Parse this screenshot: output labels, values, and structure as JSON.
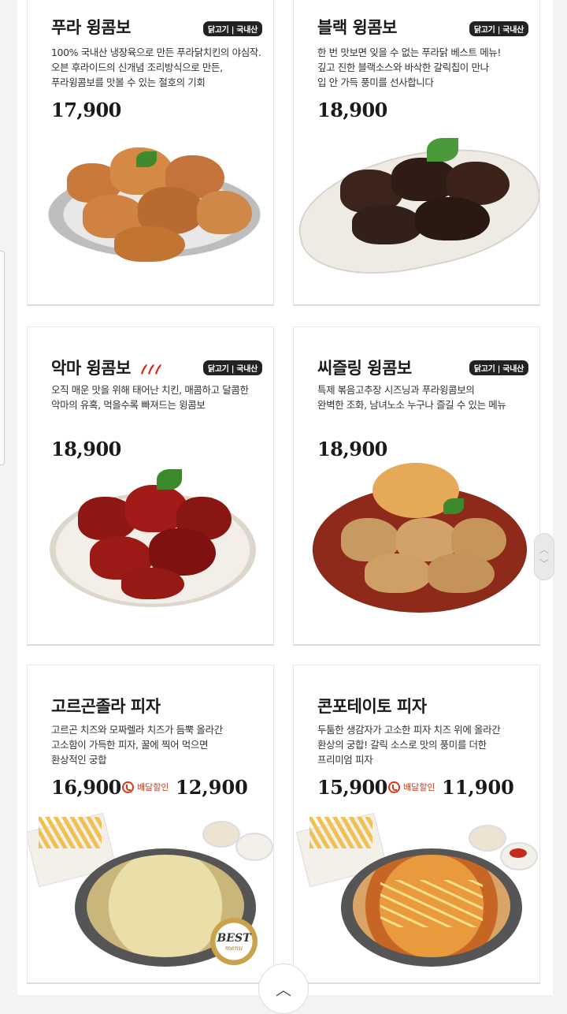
{
  "badge_text": "닭고기 | 국내산",
  "products": [
    {
      "title": "푸라 윙콤보",
      "desc": "100% 국내산 냉장육으로 만든 푸라닭치킨의 야심작.\n오븐 후라이드의 신개념 조리방식으로 만든,\n푸라윙콤보를 맛볼 수 있는 절호의 기회",
      "price": "17,900"
    },
    {
      "title": "블랙 윙콤보",
      "desc": "한 번 맛보면 잊을 수 없는 푸라닭 베스트 메뉴!\n깊고 진한 블랙소스와 바삭한 갈릭칩이 만나\n입 안 가득 풍미를 선사합니다",
      "price": "18,900"
    },
    {
      "title": "악마 윙콤보",
      "desc": "오직 매운 맛을 위해 태어난 치킨, 매콤하고 달콤한\n악마의 유혹, 먹을수록 빠져드는 윙콤보",
      "price": "18,900"
    },
    {
      "title": "씨즐링 윙콤보",
      "desc": "특제 볶음고추장 시즈닝과 푸라윙콤보의\n완벽한 조화, 남녀노소 누구나 즐길 수 있는 메뉴",
      "price": "18,900"
    },
    {
      "title": "고르곤졸라 피자",
      "desc": "고르곤 치즈와 모짜렐라 치즈가 듬뿍 올라간\n고소함이 가득한 피자, 꿀에 찍어 먹으면\n환상적인 궁합",
      "price": "16,900",
      "delivery_label": "배달할인",
      "sale_price": "12,900",
      "best_label": "BEST",
      "best_sub": "menu"
    },
    {
      "title": "콘포테이토 피자",
      "desc": "두툼한 생감자가 고소한 피자 치즈 위에 올라간\n환상의 궁합! 갈릭 소스로 맛의 풍미를 더한\n프리미엄 피자",
      "price": "15,900",
      "delivery_label": "배달할인",
      "sale_price": "11,900"
    }
  ],
  "colors": {
    "accent_red": "#d23a1a",
    "text_dark": "#1a1a1a"
  }
}
